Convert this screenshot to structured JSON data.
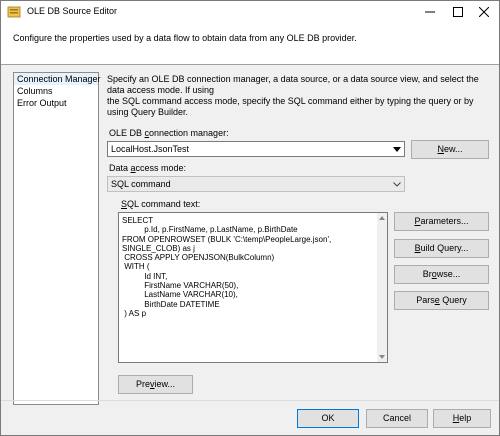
{
  "window": {
    "title": "OLE DB Source Editor",
    "description": "Configure the properties used by a data flow to obtain data from any OLE DB provider."
  },
  "nav": {
    "items": [
      {
        "label": "Connection Manager"
      },
      {
        "label": "Columns"
      },
      {
        "label": "Error Output"
      }
    ],
    "selected": "Connection Manager"
  },
  "main": {
    "info_line1": "Specify an OLE DB connection manager, a data source, or a data source view, and select the data access mode. If using",
    "info_line2": "the SQL command access mode, specify the SQL command either by typing the query or by using Query Builder.",
    "conn_label_pre": "OLE DB ",
    "conn_label_u": "c",
    "conn_label_post": "onnection manager:",
    "conn_value": "LocalHost.JsonTest",
    "new_pre": "",
    "new_u": "N",
    "new_post": "ew...",
    "access_label_pre": "Data ",
    "access_label_u": "a",
    "access_label_post": "ccess mode:",
    "access_value": "SQL command",
    "sql_label_pre": "",
    "sql_label_u": "S",
    "sql_label_post": "QL command text:",
    "sql_text": "SELECT\n\t\tp.Id, p.FirstName, p.LastName, p.BirthDate\nFROM OPENROWSET (BULK 'C:\\temp\\PeopleLarge.json',\nSINGLE_CLOB) as j\n CROSS APPLY OPENJSON(BulkColumn)\n WITH (\n\t\tId INT,\n\t\tFirstName VARCHAR(50),\n\t\tLastName VARCHAR(10),\n\t\tBirthDate DATETIME\n ) AS p",
    "parameters_pre": "",
    "parameters_u": "P",
    "parameters_post": "arameters...",
    "build_pre": "",
    "build_u": "B",
    "build_post": "uild Query...",
    "browse_pre": "Br",
    "browse_u": "o",
    "browse_post": "wse...",
    "parse_pre": "Pars",
    "parse_u": "e",
    "parse_post": " Query",
    "preview_pre": "Pre",
    "preview_u": "v",
    "preview_post": "iew..."
  },
  "footer": {
    "ok": "OK",
    "cancel": "Cancel",
    "help_u": "H",
    "help_post": "elp"
  }
}
